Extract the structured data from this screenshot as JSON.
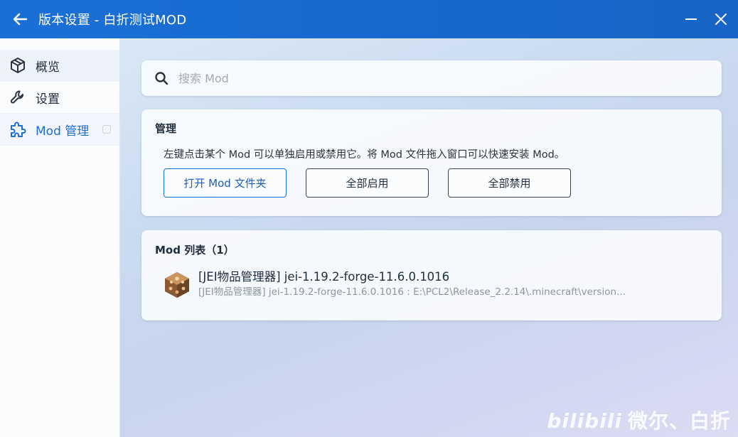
{
  "window": {
    "title": "版本设置 - 白折测试MOD",
    "accent": "#1a6fd6"
  },
  "sidebar": {
    "items": [
      {
        "label": "概览",
        "icon": "cube-icon"
      },
      {
        "label": "设置",
        "icon": "wrench-icon"
      },
      {
        "label": "Mod 管理",
        "icon": "puzzle-icon",
        "active": true
      }
    ]
  },
  "search": {
    "placeholder": "搜索 Mod",
    "value": ""
  },
  "manage": {
    "title": "管理",
    "description": "左键点击某个 Mod 可以单独启用或禁用它。将 Mod 文件拖入窗口可以快速安装 Mod。",
    "buttons": {
      "open_folder": "打开 Mod 文件夹",
      "enable_all": "全部启用",
      "disable_all": "全部禁用"
    }
  },
  "mod_list": {
    "title": "Mod 列表（1）",
    "items": [
      {
        "name": "[JEI物品管理器] jei-1.19.2-forge-11.6.0.1016",
        "detail": "[JEI物品管理器] jei-1.19.2-forge-11.6.0.1016 : E:\\PCL2\\Release_2.2.14\\.minecraft\\version..."
      }
    ]
  },
  "watermark": {
    "brand": "bilibili",
    "author": "微尔、白折"
  }
}
